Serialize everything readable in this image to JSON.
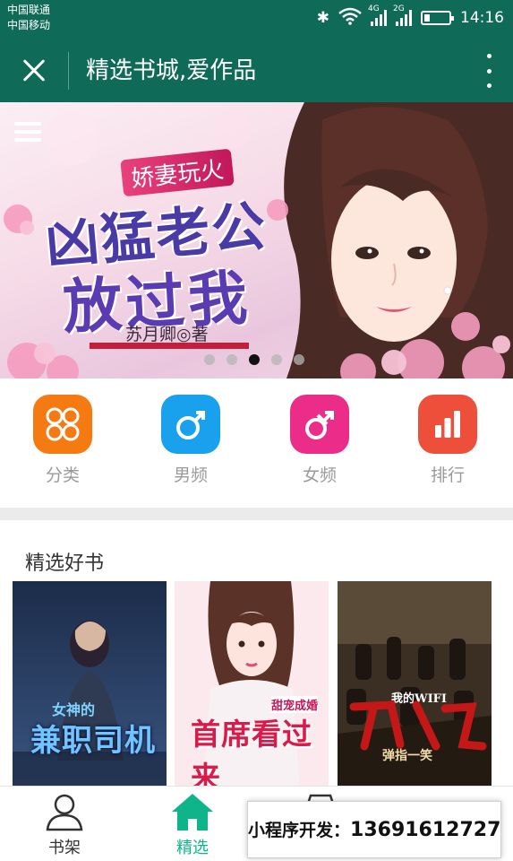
{
  "status_bar": {
    "carrier_1": "中国联通",
    "carrier_2": "中国移动",
    "network_1": "4G",
    "network_2": "2G",
    "battery_level": 0.2,
    "time": "14:16"
  },
  "nav": {
    "title": "精选书城,爱作品",
    "close_icon": "close-icon",
    "more_icon": "more-vertical-icon"
  },
  "banner": {
    "subtitle": "娇妻玩火",
    "title_line1": "凶猛老公",
    "title_line2": "放过我",
    "author": "苏月卿◎著",
    "slide_count": 5,
    "active_slide": 3
  },
  "categories": [
    {
      "label": "分类",
      "icon": "grid-icon",
      "color": "#f57a12"
    },
    {
      "label": "男频",
      "icon": "male-icon",
      "color": "#1aa1ee"
    },
    {
      "label": "女频",
      "icon": "female-icon",
      "color": "#ec2c89"
    },
    {
      "label": "排行",
      "icon": "ranking-icon",
      "color": "#ee4f3a"
    }
  ],
  "section": {
    "title": "精选好书",
    "books": [
      {
        "cover_title": "兼职司机",
        "cover_subtitle": "女神的"
      },
      {
        "cover_title": "首席看过来",
        "cover_subtitle": "甜宠成婚"
      },
      {
        "cover_title": "我的WIFI",
        "cover_subtitle": "弹指一笑"
      }
    ]
  },
  "tabs": [
    {
      "label": "书架",
      "icon": "user-icon"
    },
    {
      "label": "精选",
      "icon": "home-icon",
      "active": true
    }
  ],
  "promo": {
    "text": "小程序开发：",
    "phone": "13691612727"
  },
  "colors": {
    "header": "#0f6b57",
    "accent": "#10b48a"
  }
}
